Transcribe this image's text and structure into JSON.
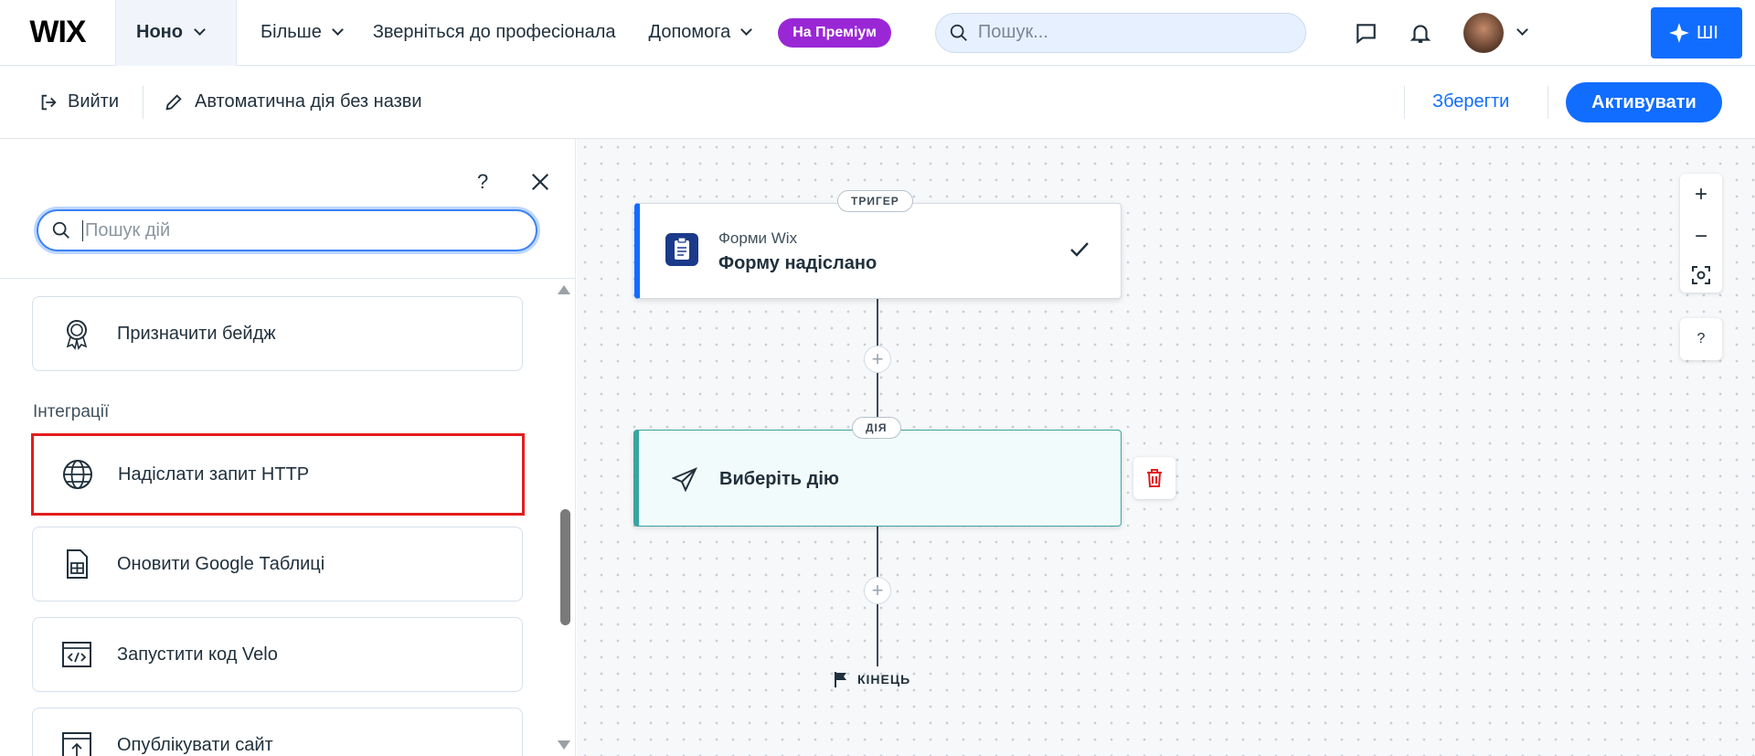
{
  "topbar": {
    "logo": "WIX",
    "site_name": "Ноно",
    "nav": {
      "more": "Більше",
      "hire": "Зверніться до професіонала",
      "help": "Допомога"
    },
    "premium": "На Преміум",
    "search_placeholder": "Пошук...",
    "ai_label": "ШІ"
  },
  "subbar": {
    "exit": "Вийти",
    "automation_name": "Автоматична дія без назви",
    "save": "Зберегти",
    "activate": "Активувати"
  },
  "panel": {
    "help": "?",
    "search_placeholder": "Пошук дій",
    "section_integrations": "Інтеграції",
    "items": [
      {
        "label": "Призначити бейдж",
        "icon": "badge-icon"
      },
      {
        "label": "Надіслати запит HTTP",
        "icon": "globe-icon"
      },
      {
        "label": "Оновити Google Таблиці",
        "icon": "spreadsheet-icon"
      },
      {
        "label": "Запустити код Velo",
        "icon": "code-icon"
      },
      {
        "label": "Опублікувати сайт",
        "icon": "publish-icon"
      }
    ]
  },
  "canvas": {
    "trigger": {
      "pill": "ТРИГЕР",
      "source": "Форми Wix",
      "title": "Форму надіслано"
    },
    "action": {
      "pill": "ДІЯ",
      "title": "Виберіть дію"
    },
    "end": "КІНЕЦЬ",
    "zoom": {
      "in": "+",
      "out": "−"
    },
    "help": "?"
  },
  "colors": {
    "accent": "#116dff",
    "premium": "#9a27d5",
    "highlight": "#e31c1c",
    "action_accent": "#3aa5a0"
  }
}
